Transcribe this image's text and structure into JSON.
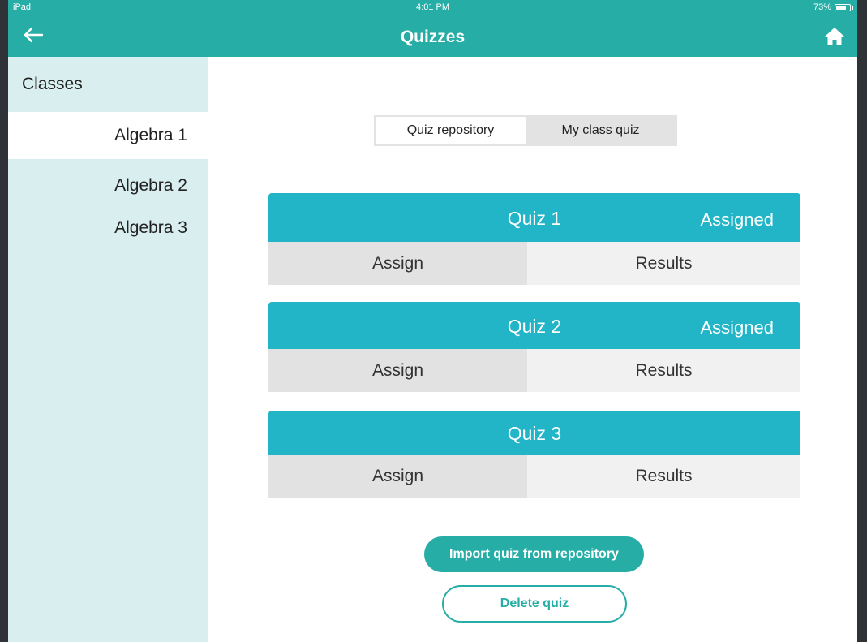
{
  "status_bar": {
    "carrier": "iPad",
    "time": "4:01 PM",
    "battery": "73%",
    "battery_level": 0.73
  },
  "nav": {
    "title": "Quizzes",
    "back_icon": "arrow-left-icon",
    "home_icon": "home-icon"
  },
  "sidebar": {
    "header": "Classes",
    "items": [
      {
        "label": "Algebra 1",
        "active": true
      },
      {
        "label": "Algebra 2",
        "active": false
      },
      {
        "label": "Algebra 3",
        "active": false
      }
    ]
  },
  "segment": {
    "options": [
      "Quiz repository",
      "My class quiz"
    ],
    "selected": "Quiz repository"
  },
  "quizzes": [
    {
      "name": "Quiz 1",
      "status": "Assigned",
      "assign_label": "Assign",
      "results_label": "Results"
    },
    {
      "name": "Quiz 2",
      "status": "Assigned",
      "assign_label": "Assign",
      "results_label": "Results"
    },
    {
      "name": "Quiz 3",
      "status": "",
      "assign_label": "Assign",
      "results_label": "Results"
    }
  ],
  "actions": {
    "import_label": "Import quiz from repository",
    "delete_label": "Delete quiz"
  },
  "colors": {
    "primary": "#26ada6",
    "quiz_header": "#21b5c7",
    "sidebar_bg": "#d9eeee"
  }
}
